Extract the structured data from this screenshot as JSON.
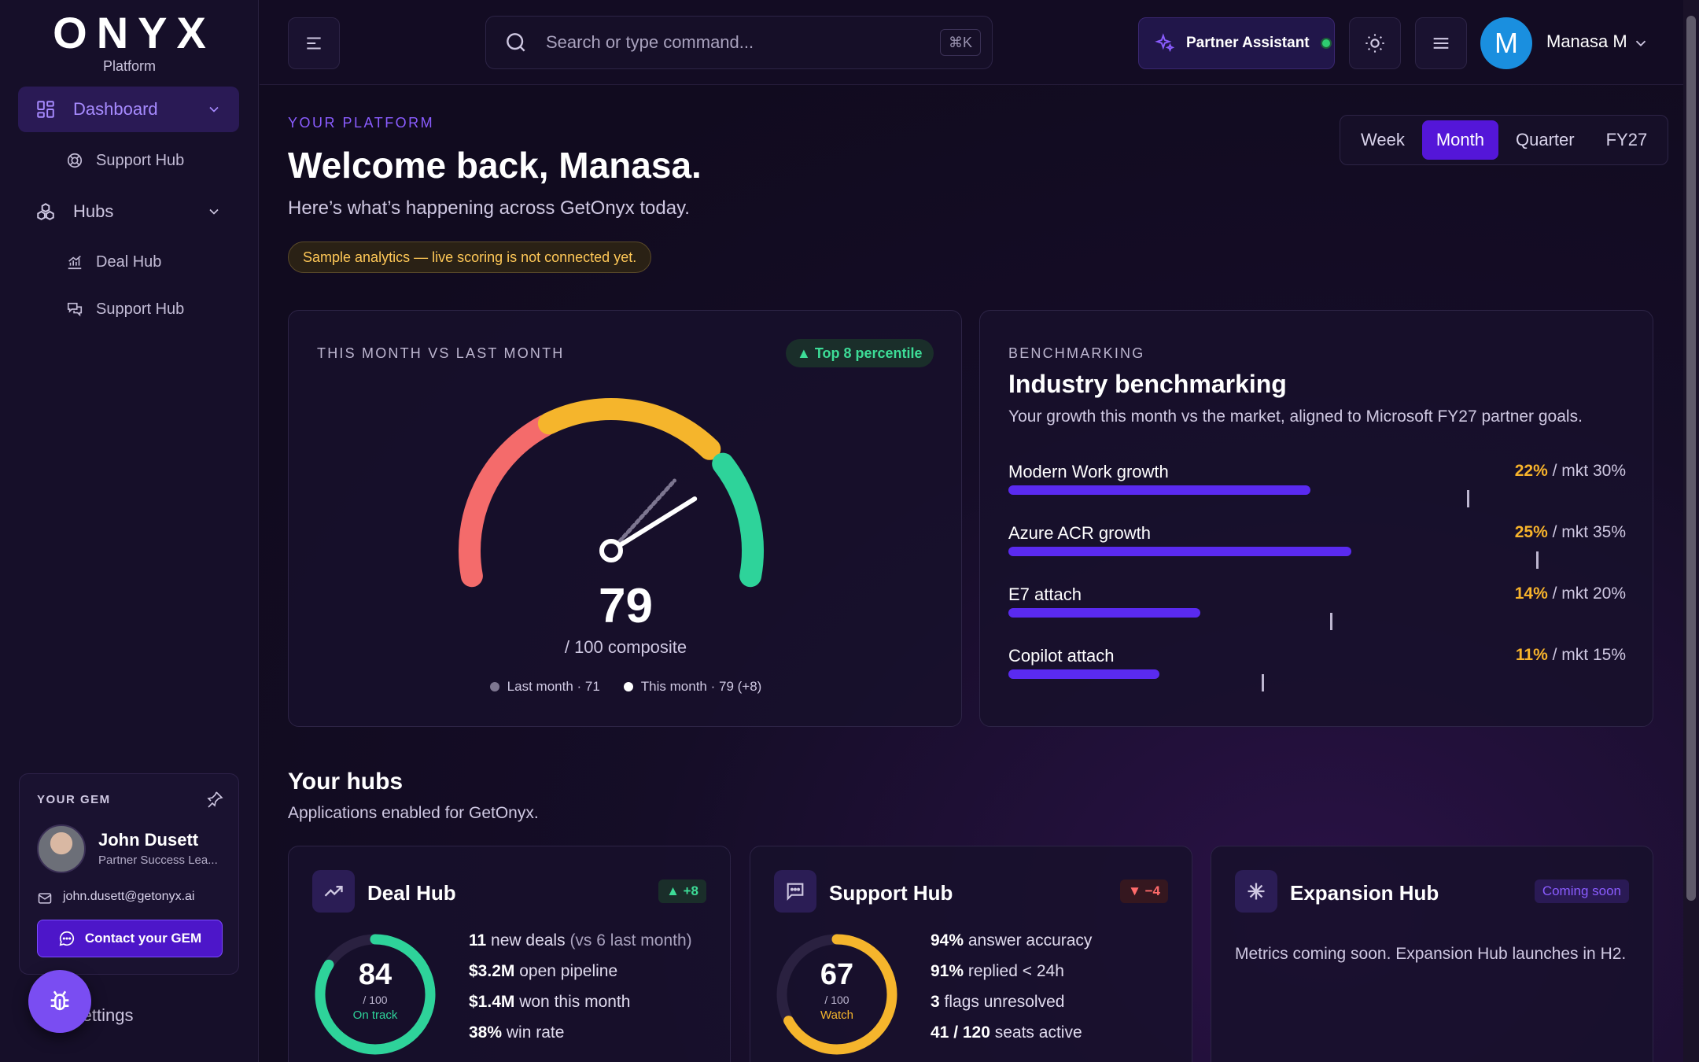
{
  "brand": {
    "name": "ONYX",
    "sub": "Platform"
  },
  "sidebar": {
    "dashboard": "Dashboard",
    "dashboard_sub": "Support Hub",
    "hubs": "Hubs",
    "hub_items": [
      "Deal Hub",
      "Support Hub"
    ],
    "settings": "Settings"
  },
  "gem": {
    "title": "YOUR GEM",
    "name": "John Dusett",
    "role": "Partner Success Lea...",
    "email": "john.dusett@getonyx.ai",
    "button": "Contact your GEM"
  },
  "topbar": {
    "search_placeholder": "Search or type command...",
    "shortcut": "⌘K",
    "assistant": "Partner Assistant",
    "user_initial": "M",
    "user_name": "Manasa M"
  },
  "header": {
    "eyebrow": "YOUR PLATFORM",
    "title": "Welcome back, Manasa.",
    "subtitle": "Here’s what’s happening across GetOnyx today.",
    "notice": "Sample analytics — live scoring is not connected yet."
  },
  "periods": {
    "items": [
      "Week",
      "Month",
      "Quarter",
      "FY27"
    ],
    "selected": "Month"
  },
  "score": {
    "eyebrow": "THIS MONTH VS LAST MONTH",
    "percentile": "▲ Top 8 percentile",
    "value": "79",
    "suffix": "/ 100 composite",
    "last_month_value": 71,
    "this_month_value": 79,
    "legend_last": "Last month · 71",
    "legend_this": "This month · 79 (+8)",
    "colors": {
      "red": "#f46b6b",
      "amber": "#f5b52c",
      "green": "#2ed39a"
    }
  },
  "benchmark": {
    "eyebrow": "BENCHMARKING",
    "title": "Industry benchmarking",
    "subtitle": "Your growth this month vs the market, aligned to Microsoft FY27 partner goals.",
    "rows": [
      {
        "label": "Modern Work growth",
        "yours": "22%",
        "market": "/ mkt 30%",
        "yours_val": 22,
        "market_val": 30
      },
      {
        "label": "Azure ACR growth",
        "yours": "25%",
        "market": "/ mkt 35%",
        "yours_val": 25,
        "market_val": 35
      },
      {
        "label": "E7 attach",
        "yours": "14%",
        "market": "/ mkt 20%",
        "yours_val": 14,
        "market_val": 20
      },
      {
        "label": "Copilot attach",
        "yours": "11%",
        "market": "/ mkt 15%",
        "yours_val": 11,
        "market_val": 15
      }
    ]
  },
  "hubs": {
    "title": "Your hubs",
    "subtitle": "Applications enabled for GetOnyx.",
    "deal": {
      "name": "Deal Hub",
      "badge": "▲ +8",
      "score": "84",
      "score_val": 84,
      "denom": "/ 100",
      "state": "On track",
      "stats": [
        {
          "strong": "11",
          "text": " new deals ",
          "muted": "(vs 6 last month)"
        },
        {
          "strong": "$3.2M",
          "text": " open pipeline",
          "muted": ""
        },
        {
          "strong": "$1.4M",
          "text": " won this month",
          "muted": ""
        },
        {
          "strong": "38%",
          "text": " win rate",
          "muted": ""
        }
      ]
    },
    "support": {
      "name": "Support Hub",
      "badge": "▼ −4",
      "score": "67",
      "score_val": 67,
      "denom": "/ 100",
      "state": "Watch",
      "stats": [
        {
          "strong": "94%",
          "text": " answer accuracy",
          "muted": ""
        },
        {
          "strong": "91%",
          "text": " replied < 24h",
          "muted": ""
        },
        {
          "strong": "3",
          "text": " flags unresolved",
          "muted": ""
        },
        {
          "strong": "41 / 120",
          "text": " seats active",
          "muted": ""
        }
      ]
    },
    "expansion": {
      "name": "Expansion Hub",
      "badge": "Coming soon",
      "description": "Metrics coming soon. Expansion Hub launches in H2."
    }
  }
}
